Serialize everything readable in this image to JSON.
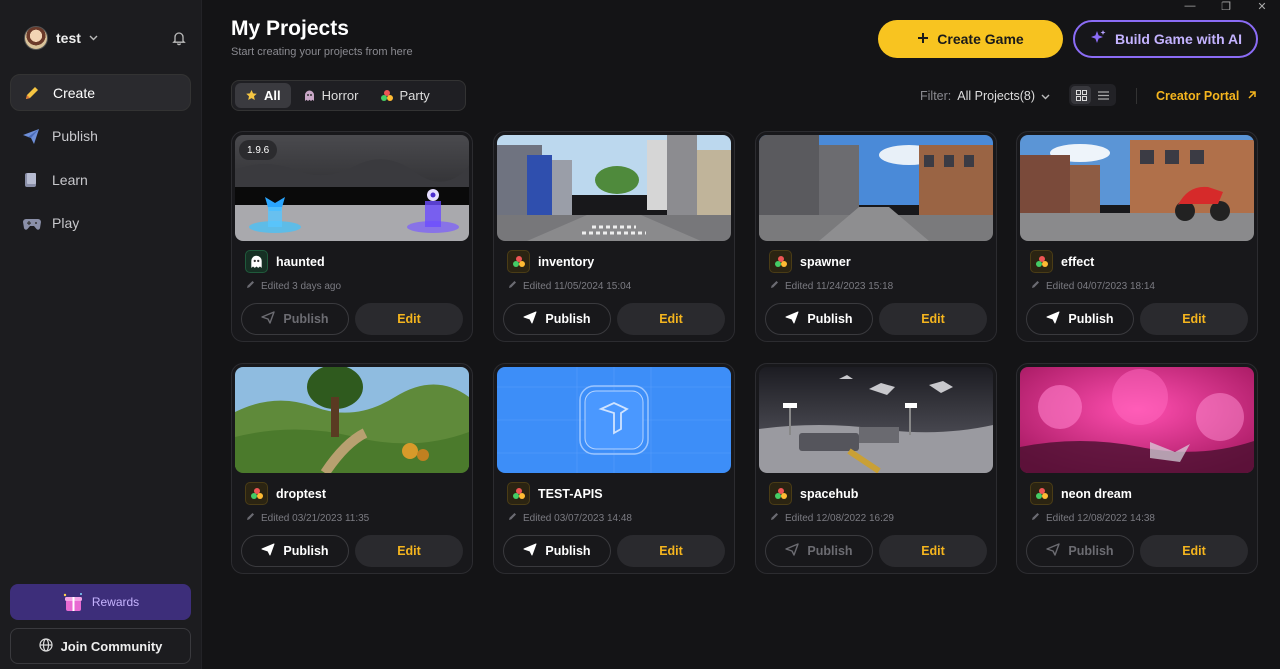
{
  "window_controls": [
    "—",
    "❐",
    "✕"
  ],
  "user": {
    "name": "test"
  },
  "nav": [
    {
      "label": "Create",
      "icon": "pencil-icon",
      "active": true
    },
    {
      "label": "Publish",
      "icon": "paper-plane-icon",
      "active": false
    },
    {
      "label": "Learn",
      "icon": "book-icon",
      "active": false
    },
    {
      "label": "Play",
      "icon": "gamepad-icon",
      "active": false
    }
  ],
  "rewards_label": "Rewards",
  "join_label": "Join Community",
  "header": {
    "title": "My Projects",
    "subtitle": "Start creating your projects from here",
    "create_label": "Create Game",
    "ai_label": "Build Game with AI"
  },
  "tabs": [
    {
      "label": "All",
      "active": true
    },
    {
      "label": "Horror",
      "active": false
    },
    {
      "label": "Party",
      "active": false
    }
  ],
  "filter": {
    "label": "Filter:",
    "value": "All Projects(8)"
  },
  "creator_portal_label": "Creator Portal",
  "colors": {
    "accent": "#f8c420",
    "ai_border": "#8b6cf6",
    "edit_text": "#f5b51e"
  },
  "projects": [
    {
      "name": "haunted",
      "edited": "Edited 3 days ago",
      "version": "1.9.6",
      "template": "ghost",
      "publish_label": "Publish",
      "publish_enabled": false,
      "edit_label": "Edit",
      "thumb": "haunted"
    },
    {
      "name": "inventory",
      "edited": "Edited 11/05/2024 15:04",
      "version": "",
      "template": "blocks",
      "publish_label": "Publish",
      "publish_enabled": true,
      "edit_label": "Edit",
      "thumb": "street"
    },
    {
      "name": "spawner",
      "edited": "Edited 11/24/2023 15:18",
      "version": "",
      "template": "blocks",
      "publish_label": "Publish",
      "publish_enabled": true,
      "edit_label": "Edit",
      "thumb": "street2"
    },
    {
      "name": "effect",
      "edited": "Edited 04/07/2023 18:14",
      "version": "",
      "template": "blocks",
      "publish_label": "Publish",
      "publish_enabled": true,
      "edit_label": "Edit",
      "thumb": "street3"
    },
    {
      "name": "droptest",
      "edited": "Edited 03/21/2023 11:35",
      "version": "",
      "template": "blocks",
      "publish_label": "Publish",
      "publish_enabled": true,
      "edit_label": "Edit",
      "thumb": "forest"
    },
    {
      "name": "TEST-APIS",
      "edited": "Edited 03/07/2023 14:48",
      "version": "",
      "template": "blocks",
      "publish_label": "Publish",
      "publish_enabled": true,
      "edit_label": "Edit",
      "thumb": "blueprint"
    },
    {
      "name": "spacehub",
      "edited": "Edited 12/08/2022 16:29",
      "version": "",
      "template": "blocks",
      "publish_label": "Publish",
      "publish_enabled": false,
      "edit_label": "Edit",
      "thumb": "moon"
    },
    {
      "name": "neon dream",
      "edited": "Edited 12/08/2022 14:38",
      "version": "",
      "template": "blocks",
      "publish_label": "Publish",
      "publish_enabled": false,
      "edit_label": "Edit",
      "thumb": "neon"
    }
  ]
}
